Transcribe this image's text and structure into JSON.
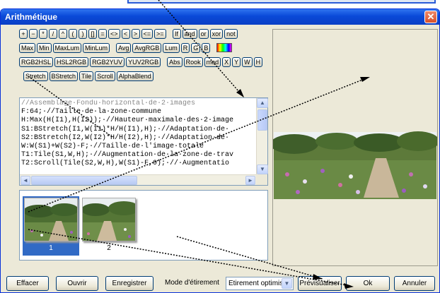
{
  "window": {
    "title": "Arithmétique",
    "close_glyph": "✕"
  },
  "toolbar": {
    "rows": [
      [
        "+",
        "−",
        "*",
        "/",
        "^",
        "(",
        ")",
        "[]",
        "=",
        "<>",
        "<",
        ">",
        "<=",
        ">=",
        "|",
        "If",
        "and",
        "or",
        "xor",
        "not"
      ],
      [
        "Max",
        "Min",
        "MaxLum",
        "MinLum",
        "|",
        "Avg",
        "AvgRGB",
        "Lum",
        "R",
        "G",
        "B",
        "|",
        "palette"
      ],
      [
        "RGB2HSL",
        "HSL2RGB",
        "RGB2YUV",
        "YUV2RGB",
        "|",
        "Abs",
        "Rook",
        "mod",
        "X",
        "Y",
        "W",
        "H"
      ],
      [
        "Stretch",
        "BStretch",
        "Tile",
        "Scroll",
        "AlphaBlend"
      ]
    ]
  },
  "editor": {
    "lines": [
      "//Assemblage·Fondu·horizontal·de·2·images",
      "F:64;·//Taille·de·la·zone·commune",
      "H:Max(H(I1),H(I2));·//Hauteur·maximale·des·2·image",
      "S1:BStretch(I1,W(I1)*H/H(I1),H);·//Adaptation·de·",
      "S2:BStretch(I2,W(I2)*H/H(I2),H);·//Adaptation·de·",
      "W:W(S1)+W(S2)-F;·//Taille·de·l'image·totale",
      "T1:Tile(S1,W,H);·//Augmentation·de·la·zone·de·trav",
      "T2:Scroll(Tile(S2,W,H),W(S1)-F,0);·//·Augmentatio"
    ],
    "scroll_up": "▲",
    "scroll_down": "▼",
    "scroll_left": "◄",
    "scroll_right": "►"
  },
  "thumbnails": [
    {
      "label": "1",
      "selected": true
    },
    {
      "label": "2",
      "selected": false
    }
  ],
  "bottom": {
    "clear": "Effacer",
    "open": "Ouvrir",
    "save": "Enregistrer",
    "stretch_mode_label": "Mode d'étirement",
    "stretch_mode_value": "Etirement optimisé",
    "preview": "Prévisualiser",
    "ok": "Ok",
    "cancel": "Annuler"
  },
  "colors": {
    "titlebar": "#0a49d8",
    "selection": "#316ac5",
    "face": "#ece9d8"
  }
}
